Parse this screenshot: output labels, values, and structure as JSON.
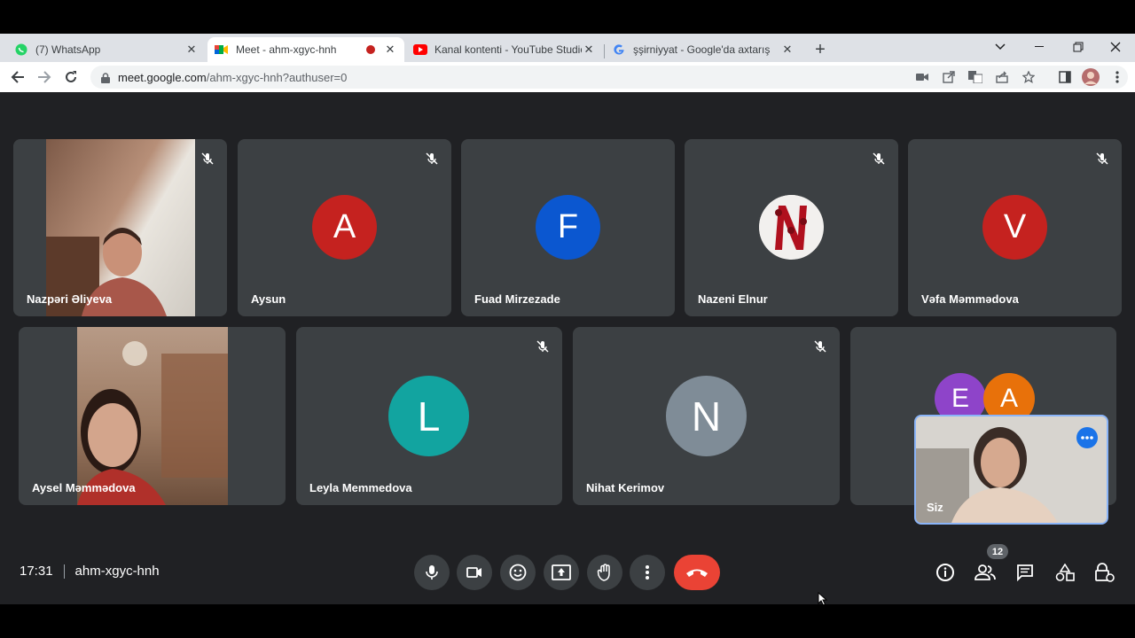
{
  "browser": {
    "tabs": [
      {
        "title": "(7) WhatsApp",
        "icon": "whatsapp-icon"
      },
      {
        "title": "Meet - ahm-xgyc-hnh",
        "icon": "google-meet-icon"
      },
      {
        "title": "Kanal kontenti - YouTube Studio",
        "icon": "youtube-icon"
      },
      {
        "title": "şşirniyyat - Google'da axtarış",
        "icon": "google-icon"
      }
    ],
    "new_tab_label": "+",
    "url_host": "meet.google.com",
    "url_path": "/ahm-xgyc-hnh?authuser=0"
  },
  "meeting": {
    "time": "17:31",
    "code": "ahm-xgyc-hnh",
    "participant_count": "12",
    "participants_row1": [
      {
        "name": "Nazpəri Əliyeva",
        "type": "video",
        "muted": true
      },
      {
        "name": "Aysun",
        "initial": "A",
        "color": "#c5221f",
        "muted": true
      },
      {
        "name": "Fuad Mirzezade",
        "initial": "F",
        "color": "#0b57d0",
        "muted": false
      },
      {
        "name": "Nazeni Elnur",
        "type": "photo",
        "muted": true
      },
      {
        "name": "Vəfa Məmmədova",
        "initial": "V",
        "color": "#c5221f",
        "muted": true
      }
    ],
    "participants_row2": [
      {
        "name": "Aysel Məmmədova",
        "type": "video",
        "muted": false
      },
      {
        "name": "Leyla Memmedova",
        "initial": "L",
        "color": "#12a4a0",
        "muted": true
      },
      {
        "name": "Nihat Kerimov",
        "initial": "N",
        "color": "#7f8c97",
        "muted": true
      }
    ],
    "overflow_avatars": [
      {
        "initial": "E",
        "color": "#8e44c9"
      },
      {
        "initial": "A",
        "color": "#e8710a"
      }
    ],
    "self_label": "Siz",
    "controls": [
      "microphone-icon",
      "camera-icon",
      "emoji-icon",
      "present-icon",
      "raise-hand-icon",
      "more-options-icon"
    ],
    "end_call_color": "#ea4335",
    "right_controls": [
      "info-icon",
      "people-icon",
      "chat-icon",
      "activities-icon",
      "host-controls-icon"
    ]
  }
}
